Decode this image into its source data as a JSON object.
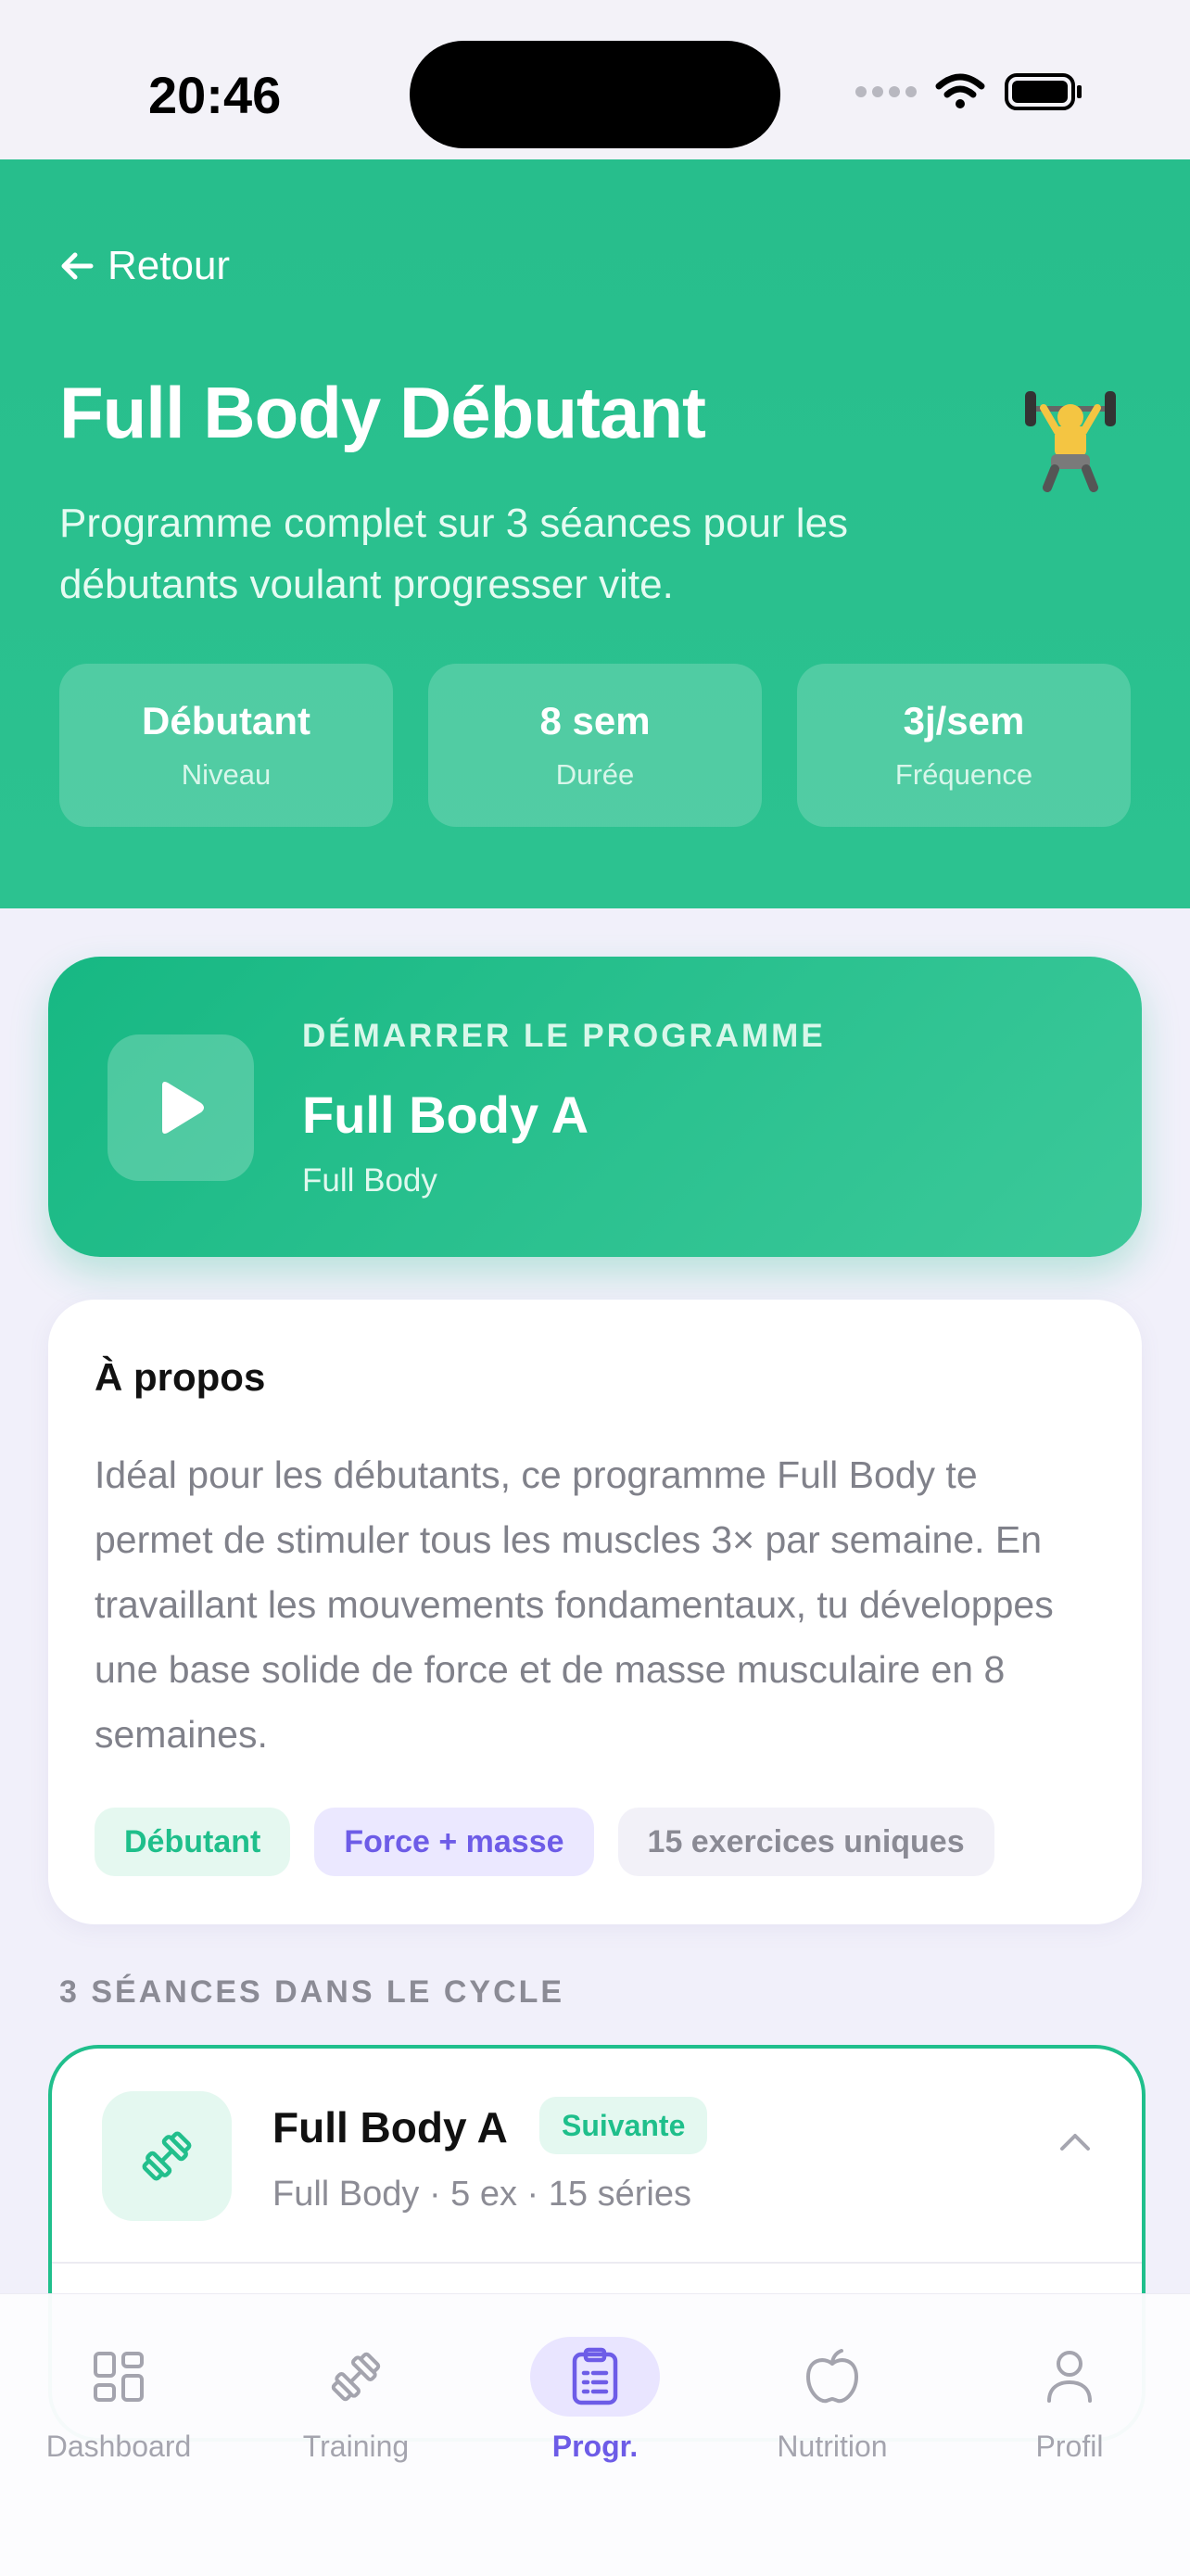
{
  "status": {
    "time": "20:46"
  },
  "header": {
    "back_label": "Retour",
    "title": "Full Body Débutant",
    "description": "Programme complet sur 3 séances pour les débutants voulant progresser vite.",
    "stats": [
      {
        "value": "Débutant",
        "label": "Niveau"
      },
      {
        "value": "8 sem",
        "label": "Durée"
      },
      {
        "value": "3j/sem",
        "label": "Fréquence"
      }
    ]
  },
  "start_card": {
    "kicker": "DÉMARRER LE PROGRAMME",
    "title": "Full Body A",
    "subtitle": "Full Body"
  },
  "about": {
    "title": "À propos",
    "text": "Idéal pour les débutants, ce programme Full Body te permet de stimuler tous les muscles 3× par semaine. En travaillant les mouvements fondamentaux, tu développes une base solide de force et de masse musculaire en 8 semaines.",
    "tags": [
      "Débutant",
      "Force + masse",
      "15 exercices uniques"
    ]
  },
  "sessions": {
    "section_title": "3 SÉANCES DANS LE CYCLE",
    "items": [
      {
        "title": "Full Body A",
        "badge": "Suivante",
        "meta": "Full Body · 5 ex · 15 séries"
      }
    ]
  },
  "tabbar": {
    "items": [
      {
        "label": "Dashboard",
        "icon": "grid-icon"
      },
      {
        "label": "Training",
        "icon": "dumbbell-icon"
      },
      {
        "label": "Progr.",
        "icon": "clipboard-icon",
        "active": true
      },
      {
        "label": "Nutrition",
        "icon": "apple-icon"
      },
      {
        "label": "Profil",
        "icon": "user-icon"
      }
    ]
  },
  "colors": {
    "primary_green": "#27be8c",
    "accent_purple": "#6d5ce7",
    "background": "#f1f0fa"
  }
}
